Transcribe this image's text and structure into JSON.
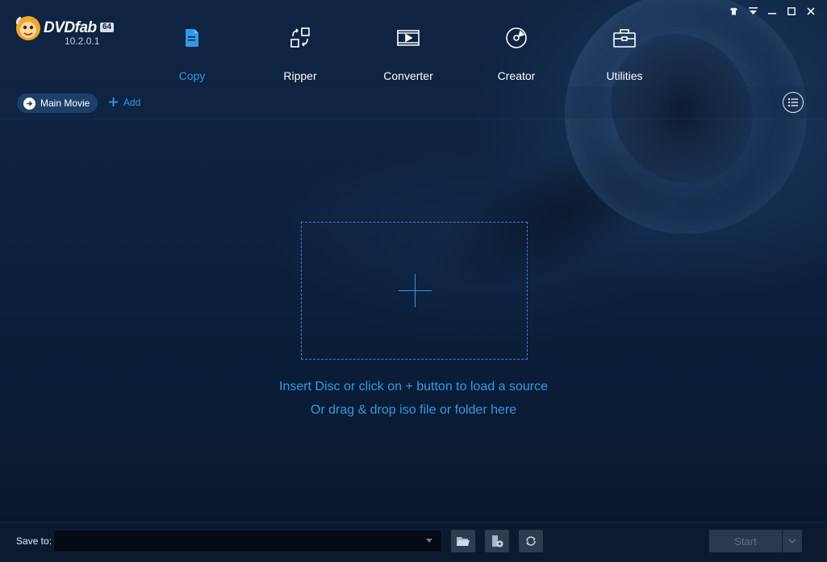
{
  "app": {
    "logo_text": "DVDfab",
    "logo_badge": "64",
    "version": "10.2.0.1"
  },
  "window_controls": [
    "skin-icon",
    "menu-icon",
    "minimize-icon",
    "maximize-icon",
    "close-icon"
  ],
  "nav": {
    "items": [
      {
        "label": "Copy",
        "icon": "copy-icon",
        "active": true
      },
      {
        "label": "Ripper",
        "icon": "ripper-icon",
        "active": false
      },
      {
        "label": "Converter",
        "icon": "converter-icon",
        "active": false
      },
      {
        "label": "Creator",
        "icon": "creator-icon",
        "active": false
      },
      {
        "label": "Utilities",
        "icon": "utilities-icon",
        "active": false
      }
    ]
  },
  "toolbar": {
    "main_movie_label": "Main Movie",
    "add_label": "Add"
  },
  "dropzone": {
    "hint_line1": "Insert Disc or click on + button to load a source",
    "hint_line2": "Or drag & drop iso file or folder here"
  },
  "bottom": {
    "save_to_label": "Save to:",
    "save_to_value": "",
    "start_label": "Start"
  },
  "colors": {
    "accent": "#2f9be6",
    "background": "#0d2240",
    "bottom_bar": "#0b1a2f"
  }
}
